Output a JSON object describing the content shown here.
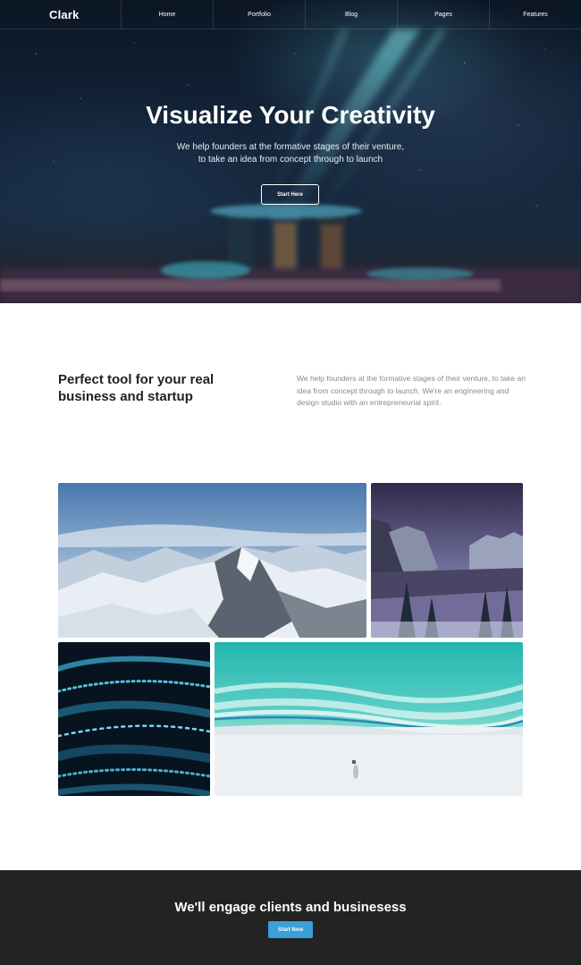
{
  "brand": "Clark",
  "nav": {
    "items": [
      "Home",
      "Portfolio",
      "Blog",
      "Pages",
      "Features"
    ]
  },
  "hero": {
    "title": "Visualize Your Creativity",
    "subtitle_line1": "We help founders at the formative stages of their venture,",
    "subtitle_line2": "to take an idea from concept through to launch",
    "button_label": "Start Here"
  },
  "intro": {
    "heading_line1": "Perfect tool for your real",
    "heading_line2": "business and startup",
    "body": "We help founders at the formative stages of their venture, to take an idea from concept through to launch. We're an engineering and design studio with an entrepreneurial spirit."
  },
  "gallery": {
    "images": [
      "snowy-mountains-photo",
      "valley-mountains-photo",
      "blue-light-bokeh-photo",
      "turquoise-beach-aerial-photo"
    ]
  },
  "cta": {
    "title": "We'll engage clients and businesess",
    "button_label": "Start Now"
  },
  "colors": {
    "accent": "#3aa0d8",
    "footer_bg": "#232323",
    "hero_bg": "#13243a"
  }
}
